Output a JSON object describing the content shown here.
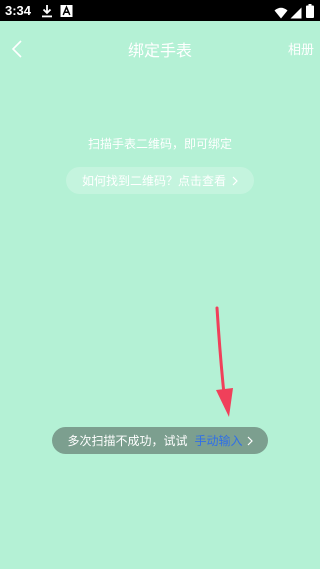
{
  "status_bar": {
    "time": "3:34",
    "icons": [
      "download-icon",
      "notification-a-icon",
      "wifi-icon",
      "signal-icon",
      "battery-icon"
    ]
  },
  "nav": {
    "back_icon": "chevron-left-icon",
    "title": "绑定手表",
    "album_label": "相册"
  },
  "scan": {
    "hint": "扫描手表二维码，即可绑定",
    "find_qr_label": "如何找到二维码？点击查看",
    "find_qr_icon": "chevron-right-icon"
  },
  "manual_entry": {
    "prefix": "多次扫描不成功，试试",
    "link_label": "手动输入",
    "link_icon": "chevron-right-icon",
    "link_color": "#2f6fe8"
  },
  "annotation": {
    "arrow_color": "#f0405a",
    "icon": "red-arrow-icon"
  },
  "colors": {
    "background": "#b4f1d5",
    "status_bar": "#000000",
    "text": "#ffffff"
  }
}
